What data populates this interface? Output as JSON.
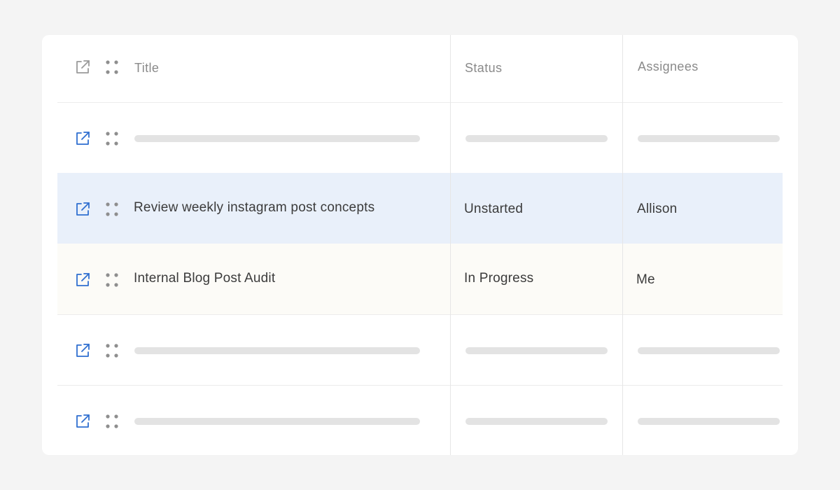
{
  "table": {
    "columns": [
      {
        "key": "title",
        "label": "Title"
      },
      {
        "key": "status",
        "label": "Status"
      },
      {
        "key": "assignees",
        "label": "Assignees"
      }
    ],
    "rows": [
      {
        "state": "loading",
        "title": "",
        "status": "",
        "assignees": ""
      },
      {
        "state": "selected",
        "title": "Review weekly instagram post concepts",
        "status": "Unstarted",
        "assignees": "Allison"
      },
      {
        "state": "highlighted",
        "title": "Internal Blog Post Audit",
        "status": "In Progress",
        "assignees": "Me"
      },
      {
        "state": "loading",
        "title": "",
        "status": "",
        "assignees": ""
      },
      {
        "state": "loading",
        "title": "",
        "status": "",
        "assignees": ""
      }
    ]
  },
  "icons": {
    "row_open": "external-edit-icon",
    "row_drag": "drag-handle-icon"
  },
  "colors": {
    "background": "#f4f4f4",
    "card": "#ffffff",
    "selected_row": "#e9f0fa",
    "highlighted_row": "#fcfbf7",
    "accent_icon": "#2f6fd0",
    "header_icon": "#9a9a9a",
    "skeleton": "#e3e3e3",
    "text": "#3b3b3b",
    "header_text": "#8a8a8a"
  }
}
